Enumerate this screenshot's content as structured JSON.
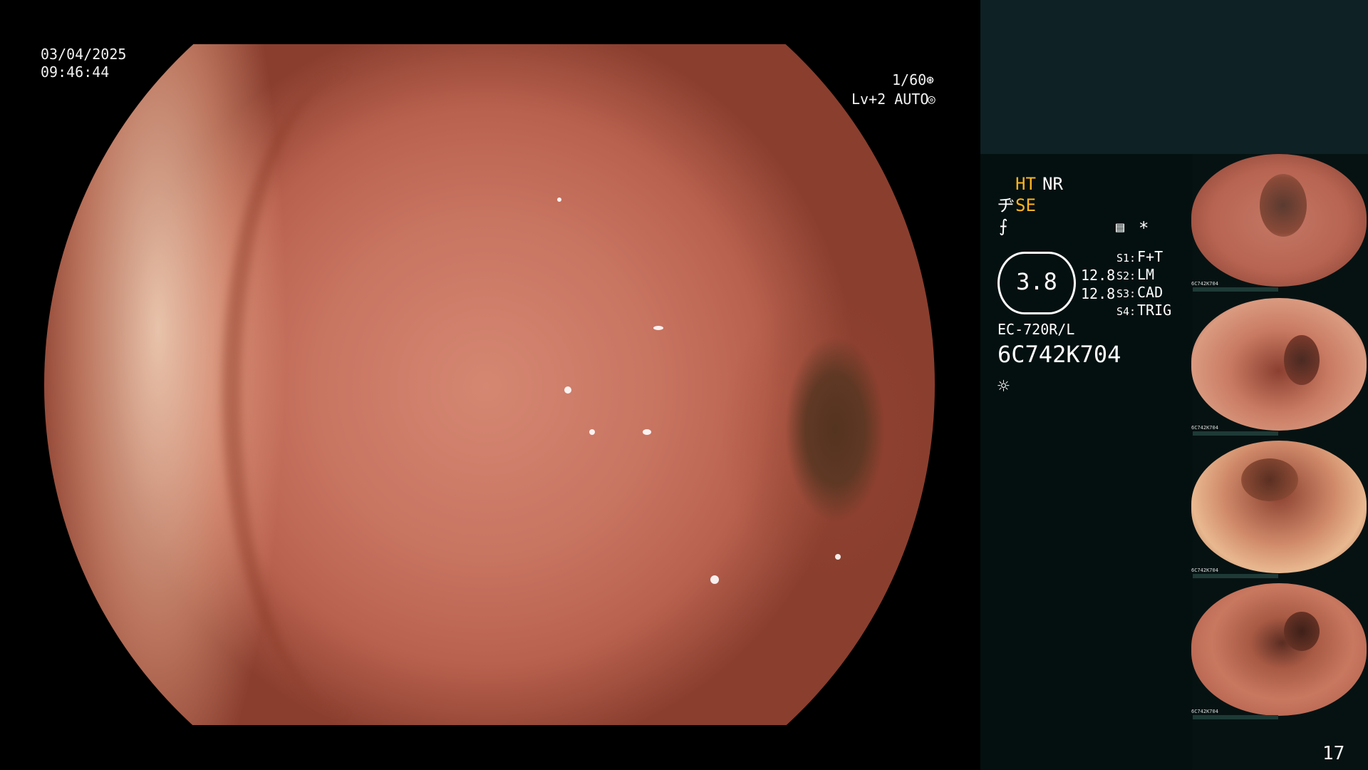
{
  "main": {
    "date": "03/04/2025",
    "time": "09:46:44",
    "shutter": "1/60",
    "level": "Lv+2 AUTO"
  },
  "panel": {
    "ht": "HT",
    "nr": "NR",
    "se": "SE",
    "gauge_value": "3.8",
    "mag_1": "12.8",
    "mag_2": "12.8",
    "s1_key": "S1:",
    "s1_val": "F+T",
    "s2_key": "S2:",
    "s2_val": "LM",
    "s3_key": "S3:",
    "s3_val": "CAD",
    "s4_key": "S4:",
    "s4_val": "TRIG",
    "scope_model": "EC-720R/L",
    "scope_serial": "6C742K704",
    "asterisk": "*"
  },
  "thumbnails": [
    {
      "label": "6C742K704"
    },
    {
      "label": "6C742K704"
    },
    {
      "label": "6C742K704"
    },
    {
      "label": "6C742K704"
    }
  ],
  "footer": {
    "page_number": "17"
  },
  "colors": {
    "accent_yellow": "#ffb520",
    "panel_bg": "#041010",
    "panel_top_bg": "#0e2124"
  }
}
